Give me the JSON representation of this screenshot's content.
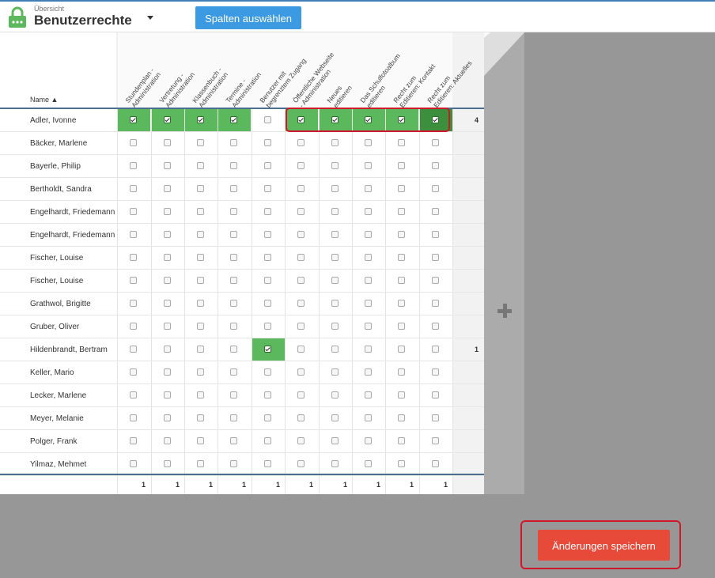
{
  "header": {
    "breadcrumb": "Übersicht",
    "title": "Benutzerrechte",
    "select_columns_label": "Spalten auswählen"
  },
  "table": {
    "name_header": "Name ▲",
    "columns": [
      "Stundenplan -\nAdministration",
      "Vertretung -\nAdministration",
      "Klassenbuch -\nAdministration",
      "Termine -\nAdministration",
      "Benutzer mit\nbegrenztem Zugang",
      "Öffentliche Webseite\n- Administration",
      "Neues\neditieren",
      "Das Schulfotoalbum\neditieren",
      "Recht zum\nEditieren: Kontakt",
      "Recht zum\nEditieren: Aktuelles"
    ],
    "rows": [
      {
        "name": "Adler, Ivonne",
        "checks": [
          true,
          true,
          true,
          true,
          false,
          true,
          true,
          true,
          true,
          true
        ],
        "count": "4"
      },
      {
        "name": "Bäcker, Marlene",
        "checks": [
          false,
          false,
          false,
          false,
          false,
          false,
          false,
          false,
          false,
          false
        ],
        "count": ""
      },
      {
        "name": "Bayerle, Philip",
        "checks": [
          false,
          false,
          false,
          false,
          false,
          false,
          false,
          false,
          false,
          false
        ],
        "count": ""
      },
      {
        "name": "Bertholdt, Sandra",
        "checks": [
          false,
          false,
          false,
          false,
          false,
          false,
          false,
          false,
          false,
          false
        ],
        "count": ""
      },
      {
        "name": "Engelhardt, Friedemann",
        "checks": [
          false,
          false,
          false,
          false,
          false,
          false,
          false,
          false,
          false,
          false
        ],
        "count": ""
      },
      {
        "name": "Engelhardt, Friedemann",
        "checks": [
          false,
          false,
          false,
          false,
          false,
          false,
          false,
          false,
          false,
          false
        ],
        "count": ""
      },
      {
        "name": "Fischer, Louise",
        "checks": [
          false,
          false,
          false,
          false,
          false,
          false,
          false,
          false,
          false,
          false
        ],
        "count": ""
      },
      {
        "name": "Fischer, Louise",
        "checks": [
          false,
          false,
          false,
          false,
          false,
          false,
          false,
          false,
          false,
          false
        ],
        "count": ""
      },
      {
        "name": "Grathwol, Brigitte",
        "checks": [
          false,
          false,
          false,
          false,
          false,
          false,
          false,
          false,
          false,
          false
        ],
        "count": ""
      },
      {
        "name": "Gruber, Oliver",
        "checks": [
          false,
          false,
          false,
          false,
          false,
          false,
          false,
          false,
          false,
          false
        ],
        "count": ""
      },
      {
        "name": "Hildenbrandt, Bertram",
        "checks": [
          false,
          false,
          false,
          false,
          true,
          false,
          false,
          false,
          false,
          false
        ],
        "count": "1"
      },
      {
        "name": "Keller, Mario",
        "checks": [
          false,
          false,
          false,
          false,
          false,
          false,
          false,
          false,
          false,
          false
        ],
        "count": ""
      },
      {
        "name": "Lecker, Marlene",
        "checks": [
          false,
          false,
          false,
          false,
          false,
          false,
          false,
          false,
          false,
          false
        ],
        "count": ""
      },
      {
        "name": "Meyer, Melanie",
        "checks": [
          false,
          false,
          false,
          false,
          false,
          false,
          false,
          false,
          false,
          false
        ],
        "count": ""
      },
      {
        "name": "Polger, Frank",
        "checks": [
          false,
          false,
          false,
          false,
          false,
          false,
          false,
          false,
          false,
          false
        ],
        "count": ""
      },
      {
        "name": "Yilmaz, Mehmet",
        "checks": [
          false,
          false,
          false,
          false,
          false,
          false,
          false,
          false,
          false,
          false
        ],
        "count": ""
      }
    ],
    "column_totals": [
      "1",
      "1",
      "1",
      "1",
      "1",
      "1",
      "1",
      "1",
      "1",
      "1"
    ]
  },
  "save_label": "Änderungen speichern",
  "colors": {
    "checked": "#5cb85c",
    "checked_dark": "#3c8f3c",
    "primary": "#3b9ae1",
    "save": "#e84a3a",
    "highlight": "#d0182b"
  }
}
